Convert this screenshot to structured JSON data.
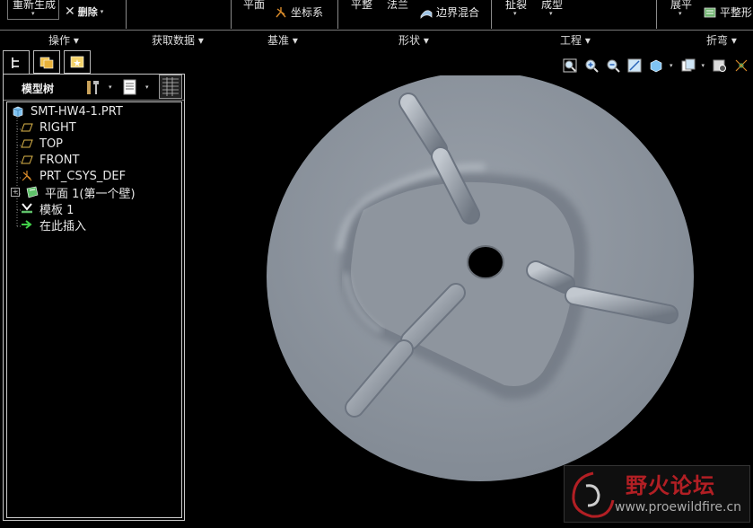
{
  "ribbon": {
    "regenerate_label": "重新生成",
    "delete_label": "删除",
    "plane_label": "平面",
    "csys_label": "坐标系",
    "flat_label": "平整",
    "flange_label": "法兰",
    "boundary_blend_label": "边界混合",
    "extrude_label": "扯裂",
    "form_label": "成型",
    "unbend_label": "展平",
    "flatten_form_label": "平整形",
    "groups": [
      "操作 ▾",
      "获取数据 ▾",
      "基准 ▾",
      "形状 ▾",
      "工程 ▾",
      "折弯 ▾"
    ]
  },
  "model_tree": {
    "title": "模型树",
    "items": [
      {
        "label": "SMT-HW4-1.PRT",
        "icon": "part-icon"
      },
      {
        "label": "RIGHT",
        "icon": "datum-plane-icon"
      },
      {
        "label": "TOP",
        "icon": "datum-plane-icon"
      },
      {
        "label": "FRONT",
        "icon": "datum-plane-icon"
      },
      {
        "label": "PRT_CSYS_DEF",
        "icon": "csys-icon"
      },
      {
        "label": "平面 1(第一个壁)",
        "icon": "wall-icon"
      },
      {
        "label": "模板 1",
        "icon": "form-icon"
      },
      {
        "label": "在此插入",
        "icon": "insert-arrow-icon"
      }
    ]
  },
  "watermark": {
    "site_name": "野火论坛",
    "url": "www.proewildfire.cn"
  },
  "colors": {
    "background": "#000000",
    "part_fill": "#8d959e",
    "tree_text": "#e8e8e8",
    "watermark_red": "#b21f24"
  }
}
